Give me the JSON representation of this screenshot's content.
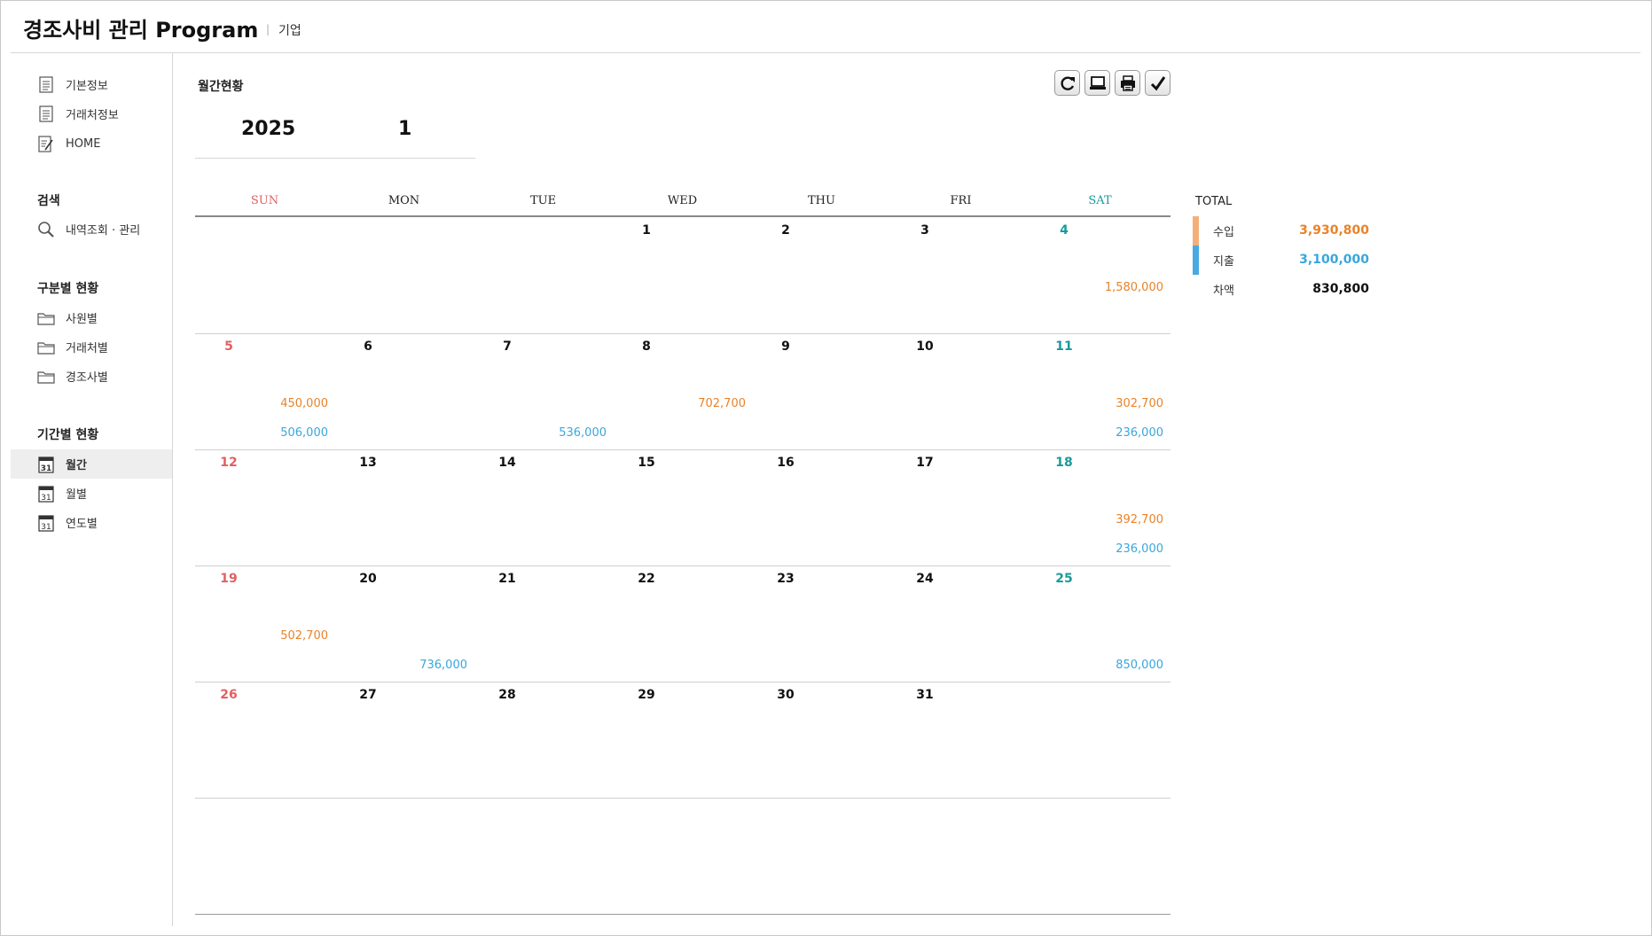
{
  "app": {
    "title": "경조사비 관리 Program",
    "separator": "|",
    "subtitle": "기업"
  },
  "sidebar": {
    "top_items": [
      {
        "label": "기본정보",
        "icon": "document-icon"
      },
      {
        "label": "거래처정보",
        "icon": "document-icon"
      },
      {
        "label": "HOME",
        "icon": "edit-document-icon"
      }
    ],
    "search_section": "검색",
    "search_items": [
      {
        "label": "내역조회 · 관리",
        "icon": "search-icon"
      }
    ],
    "category_section": "구분별 현황",
    "category_items": [
      {
        "label": "사원별",
        "icon": "folder-icon"
      },
      {
        "label": "거래처별",
        "icon": "folder-icon"
      },
      {
        "label": "경조사별",
        "icon": "folder-icon"
      }
    ],
    "period_section": "기간별 현황",
    "period_items": [
      {
        "label": "월간",
        "icon": "calendar-icon",
        "active": true
      },
      {
        "label": "월별",
        "icon": "calendar-icon",
        "active": false
      },
      {
        "label": "연도별",
        "icon": "calendar-icon",
        "active": false
      }
    ],
    "calendar_icon_text": "31"
  },
  "main": {
    "title": "월간현황",
    "year": "2025",
    "month": "1",
    "toolbar": [
      "refresh-icon",
      "monitor-icon",
      "print-icon",
      "check-icon"
    ]
  },
  "calendar": {
    "weekdays": [
      "SUN",
      "MON",
      "TUE",
      "WED",
      "THU",
      "FRI",
      "SAT"
    ],
    "weekday_colors": [
      "#e06060",
      "#222222",
      "#222222",
      "#222222",
      "#222222",
      "#222222",
      "#199a9a"
    ],
    "weeks": [
      [
        null,
        null,
        null,
        {
          "day": "1"
        },
        {
          "day": "2"
        },
        {
          "day": "3"
        },
        {
          "day": "4",
          "income": "1,580,000"
        }
      ],
      [
        {
          "day": "5",
          "income": "450,000",
          "expense": "506,000"
        },
        {
          "day": "6"
        },
        {
          "day": "7",
          "expense": "536,000"
        },
        {
          "day": "8",
          "income": "702,700"
        },
        {
          "day": "9"
        },
        {
          "day": "10"
        },
        {
          "day": "11",
          "income": "302,700",
          "expense": "236,000"
        }
      ],
      [
        {
          "day": "12"
        },
        {
          "day": "13"
        },
        {
          "day": "14"
        },
        {
          "day": "15"
        },
        {
          "day": "16"
        },
        {
          "day": "17"
        },
        {
          "day": "18",
          "income": "392,700",
          "expense": "236,000"
        }
      ],
      [
        {
          "day": "19",
          "income": "502,700"
        },
        {
          "day": "20",
          "expense": "736,000"
        },
        {
          "day": "21"
        },
        {
          "day": "22"
        },
        {
          "day": "23"
        },
        {
          "day": "24"
        },
        {
          "day": "25",
          "expense": "850,000"
        }
      ],
      [
        {
          "day": "26"
        },
        {
          "day": "27"
        },
        {
          "day": "28"
        },
        {
          "day": "29"
        },
        {
          "day": "30"
        },
        {
          "day": "31"
        },
        null
      ]
    ]
  },
  "totals": {
    "label": "TOTAL",
    "income_label": "수입",
    "income": "3,930,800",
    "expense_label": "지출",
    "expense": "3,100,000",
    "balance_label": "차액",
    "balance": "830,800"
  },
  "colors": {
    "income": "#e8832a",
    "expense": "#3aa6dc",
    "income_bar": "#f4b07a",
    "expense_bar": "#49a9e2",
    "sunday": "#e06060",
    "saturday": "#199a9a"
  }
}
